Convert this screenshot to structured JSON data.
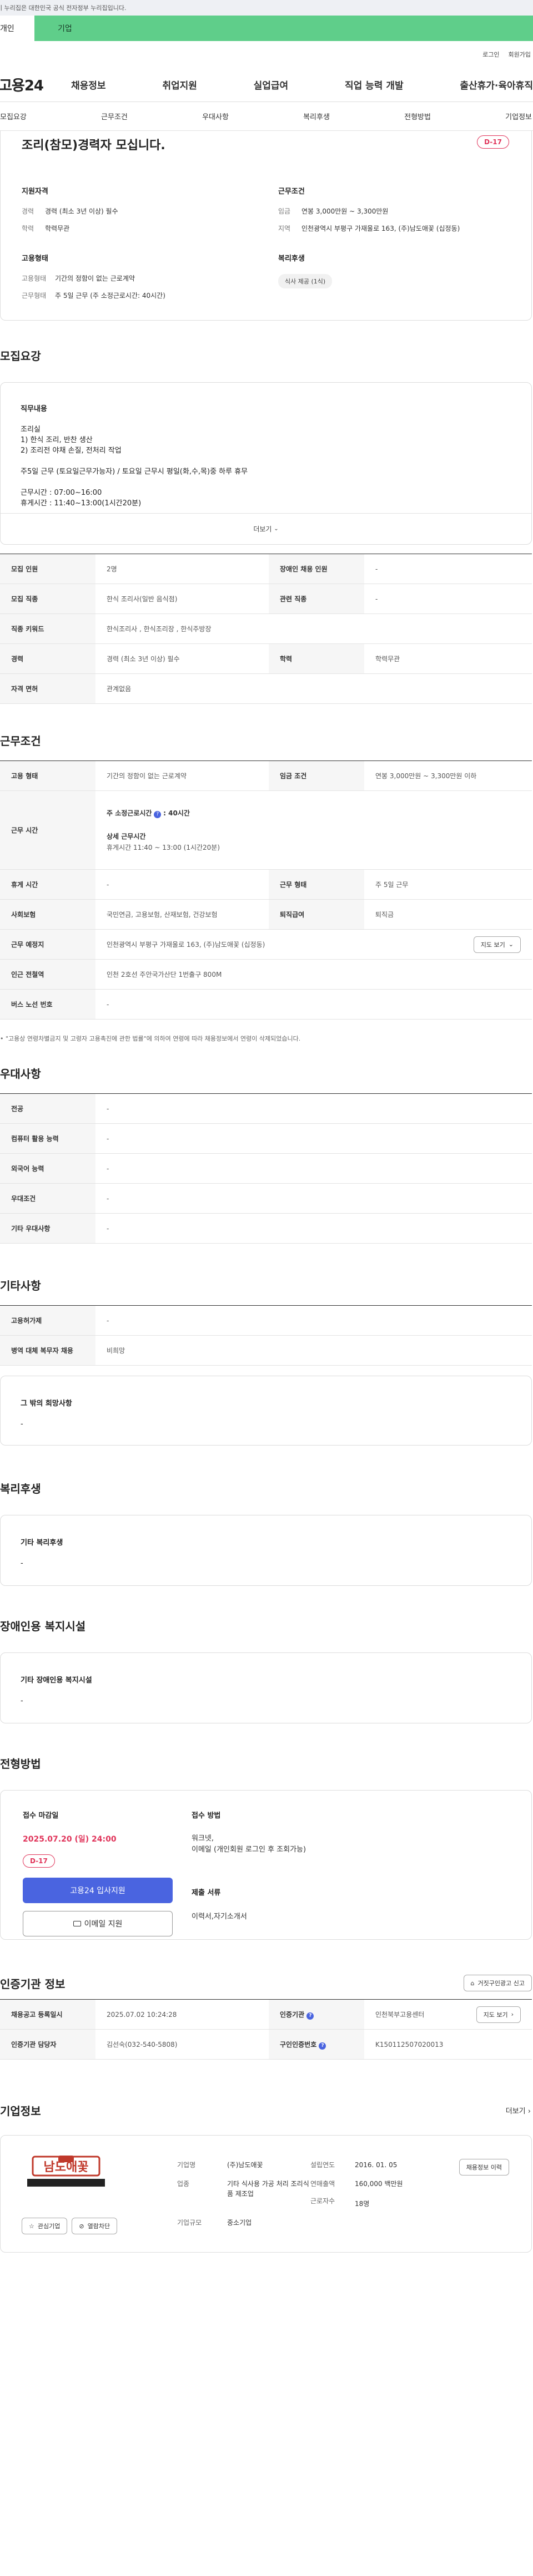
{
  "gov_banner": "이 누리집은 대한민국 공식 전자정부 누리집입니다.",
  "user_tabs": {
    "personal": "개인",
    "corporate": "기업"
  },
  "util": {
    "login": "로그인",
    "signup": "회원가입"
  },
  "logo": "고용24",
  "gnb": [
    "채용정보",
    "취업지원",
    "실업급여",
    "직업 능력 개발",
    "출산휴가·육아휴직"
  ],
  "subnav": [
    "모집요강",
    "근무조건",
    "우대사항",
    "복리후생",
    "전형방법",
    "기업정보"
  ],
  "summary": {
    "title": "조리(참모)경력자 모십니다.",
    "dday": "D-17",
    "qual_heading": "지원자격",
    "qual": [
      {
        "k": "경력",
        "v": "경력 (최소 3년 이상) 필수"
      },
      {
        "k": "학력",
        "v": "학력무관"
      }
    ],
    "cond_heading": "근무조건",
    "cond": [
      {
        "k": "임금",
        "v": "연봉 3,000만원 ~ 3,300만원"
      },
      {
        "k": "지역",
        "v": "인천광역시 부평구 가재울로 163, (주)남도애꽃 (십정동)"
      }
    ],
    "emp_heading": "고용형태",
    "emp": [
      {
        "k": "고용형태",
        "v": "기간의 정함이 없는 근로계약"
      },
      {
        "k": "근무형태",
        "v": "주 5일 근무 (주 소정근로시간: 40시간)"
      }
    ],
    "welfare_heading": "복리후생",
    "welfare_chip": "식사 제공 (1식)"
  },
  "recruit": {
    "heading": "모집요강",
    "duty_heading": "직무내용",
    "duty_lines": [
      "조리실",
      "1) 한식 조리, 반찬 생산",
      "2) 조리전 야채 손질, 전처리 작업",
      "",
      "주5일 근무 (토요일근무가능자) / 토요일 근무시 평일(화,수,목)중 하루 휴무",
      "",
      "근무시간 : 07:00~16:00",
      "휴게시간 : 11:40~13:00(1시간20분)"
    ],
    "more": "더보기",
    "rows": [
      [
        {
          "k": "모집 인원",
          "v": "2명"
        },
        {
          "k": "장애인 채용 인원",
          "v": "-"
        }
      ],
      [
        {
          "k": "모집 직종",
          "v": "한식 조리사(일반 음식점)"
        },
        {
          "k": "관련 직종",
          "v": "-"
        }
      ],
      [
        {
          "k": "직종 키워드",
          "v": "한식조리사 , 한식조리장 , 한식주방장"
        }
      ],
      [
        {
          "k": "경력",
          "v": "경력 (최소 3년 이상) 필수"
        },
        {
          "k": "학력",
          "v": "학력무관"
        }
      ],
      [
        {
          "k": "자격 면허",
          "v": "관계없음"
        }
      ]
    ]
  },
  "work": {
    "heading": "근무조건",
    "type_k": "고용 형태",
    "type_v": "기간의 정함이 없는 근로계약",
    "wage_k": "임금 조건",
    "wage_v": "연봉 3,000만원 ~ 3,300만원 이하",
    "time_k": "근무 시간",
    "time_v1": "주 소정근로시간",
    "time_v1b": ": 40시간",
    "time_v2": "상세 근무시간",
    "time_v3": "휴게시간 11:40 ~ 13:00 (1시간20분)",
    "rest_k": "휴게 시간",
    "rest_v": "-",
    "form_k": "근무 형태",
    "form_v": "주 5일 근무",
    "ins_k": "사회보험",
    "ins_v": "국민연금, 고용보험, 산재보험, 건강보험",
    "ret_k": "퇴직급여",
    "ret_v": "퇴직금",
    "place_k": "근무 예정지",
    "place_v": "인천광역시 부평구 가재울로 163, (주)남도애꽃 (십정동)",
    "map_btn": "지도 보기",
    "sub_k": "인근 전철역",
    "sub_v": "인천 2호선 주안국가산단 1번출구 800M",
    "bus_k": "버스 노선 번호",
    "bus_v": "-",
    "note": "\"고용상 연령차별금지 및 고령자 고용촉진에 관한 법률\"에 의하여 연령에 따라 채용정보에서 연령이 삭제되었습니다."
  },
  "pref": {
    "heading": "우대사항",
    "rows": [
      {
        "k": "전공",
        "v": "-"
      },
      {
        "k": "컴퓨터 활용 능력",
        "v": "-"
      },
      {
        "k": "외국어 능력",
        "v": "-"
      },
      {
        "k": "우대조건",
        "v": "-"
      },
      {
        "k": "기타 우대사항",
        "v": "-"
      }
    ]
  },
  "etc": {
    "heading": "기타사항",
    "rows": [
      {
        "k": "고용허가제",
        "v": "-"
      },
      {
        "k": "병역 대체 복무자 채용",
        "v": "비희망"
      }
    ],
    "other_heading": "그 밖의 희망사항",
    "other_v": "-"
  },
  "welfare": {
    "heading": "복리후생",
    "box_heading": "기타 복리후생",
    "box_v": "-"
  },
  "disabled": {
    "heading": "장애인용 복지시설",
    "box_heading": "기타 장애인용 복지시설",
    "box_v": "-"
  },
  "selection": {
    "heading": "전형방법",
    "deadline_heading": "접수 마감일",
    "deadline": "2025.07.20 (일) 24:00",
    "dday": "D-17",
    "apply_btn": "고용24 입사지원",
    "email_btn": "이메일 지원",
    "method_heading": "접수 방법",
    "method": [
      "워크넷,",
      "이메일 (개인회원 로그인 후 조회가능)"
    ],
    "docs_heading": "제출 서류",
    "docs": "이력서,자기소개서"
  },
  "cert": {
    "heading": "인증기관 정보",
    "report_btn": "거짓구인광고 신고",
    "reg_k": "채용공고 등록일시",
    "reg_v": "2025.07.02 10:24:28",
    "org_k": "인증기관",
    "org_v": "인천북부고용센터",
    "map_btn": "지도 보기",
    "mgr_k": "인증기관 담당자",
    "mgr_v": "김선숙(032-540-5808)",
    "cert_k": "구인인증번호",
    "cert_v": "K150112507020013"
  },
  "company": {
    "heading": "기업정보",
    "more": "더보기",
    "logo_text": "남도애꽃",
    "fav_btn": "관심기업",
    "block_btn": "열람차단",
    "name_k": "기업명",
    "name_v": "(주)남도애꽃",
    "year_k": "설립연도",
    "year_v": "2016. 01. 05",
    "ind_k": "업종",
    "ind_v": "기타 식사용 가공 처리 조리식품 제조업",
    "sales_k": "연매출액",
    "sales_v": "160,000 백만원",
    "emp_k": "근로자수",
    "emp_v": "18명",
    "scale_k": "기업규모",
    "scale_v": "중소기업",
    "jobs_btn": "채용정보 이력"
  },
  "colors": {
    "accent_green": "#5fce8a",
    "dday_red": "#e0345a",
    "apply_blue": "#4a64e0"
  }
}
